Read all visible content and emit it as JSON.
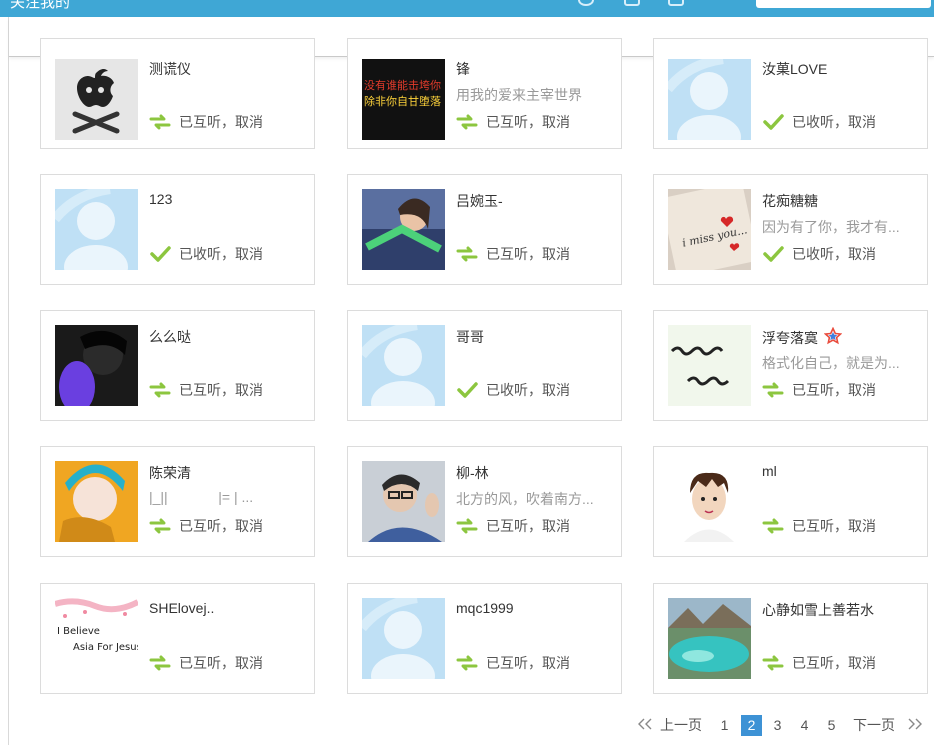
{
  "topbar": {
    "title": "关注我的",
    "accent": "#3fa7d5"
  },
  "cards": [
    {
      "name": "测谎仪",
      "signature": "",
      "status_icon": "mutual-arrows-icon",
      "status": "已互听，",
      "cancel": "取消",
      "avatar": "apple-skull"
    },
    {
      "name": "锋",
      "signature": "用我的爱来主宰世界",
      "status_icon": "mutual-arrows-icon",
      "status": "已互听，",
      "cancel": "取消",
      "avatar": "dark-text"
    },
    {
      "name": "汝菓LOVE",
      "signature": "",
      "status_icon": "check-icon",
      "status": "已收听，",
      "cancel": "取消",
      "avatar": "default"
    },
    {
      "name": "123",
      "signature": "",
      "status_icon": "check-icon",
      "status": "已收听，",
      "cancel": "取消",
      "avatar": "default"
    },
    {
      "name": "吕婉玉-",
      "signature": "",
      "status_icon": "mutual-arrows-icon",
      "status": "已互听，",
      "cancel": "取消",
      "avatar": "girl-photo"
    },
    {
      "name": "花痴糖糖",
      "signature": "因为有了你，我才有...",
      "status_icon": "check-icon",
      "status": "已收听，",
      "cancel": "取消",
      "avatar": "miss-you"
    },
    {
      "name": "么么哒",
      "signature": "",
      "status_icon": "mutual-arrows-icon",
      "status": "已互听，",
      "cancel": "取消",
      "avatar": "dark-purple"
    },
    {
      "name": "哥哥",
      "signature": "",
      "status_icon": "check-icon",
      "status": "已收听，",
      "cancel": "取消",
      "avatar": "default"
    },
    {
      "name": "浮夸落寞",
      "signature": "格式化自己，就是为...",
      "status_icon": "mutual-arrows-icon",
      "status": "已互听，",
      "cancel": "取消",
      "avatar": "handwriting",
      "badge": "star-icon"
    },
    {
      "name": "陈荣清",
      "signature": "|_||             |= | ...",
      "status_icon": "mutual-arrows-icon",
      "status": "已互听，",
      "cancel": "取消",
      "avatar": "orange-hood"
    },
    {
      "name": "柳-林",
      "signature": "北方的风，吹着南方...",
      "status_icon": "mutual-arrows-icon",
      "status": "已互听，",
      "cancel": "取消",
      "avatar": "boy-glasses"
    },
    {
      "name": "ml",
      "signature": "",
      "status_icon": "mutual-arrows-icon",
      "status": "已互听，",
      "cancel": "取消",
      "avatar": "cartoon-boy"
    },
    {
      "name": "SHElovej..",
      "signature": "",
      "status_icon": "mutual-arrows-icon",
      "status": "已互听，",
      "cancel": "取消",
      "avatar": "i-believe",
      "avatar_text": [
        "I Believe",
        "Asia For Jesus"
      ]
    },
    {
      "name": "mqc1999",
      "signature": "",
      "status_icon": "mutual-arrows-icon",
      "status": "已互听，",
      "cancel": "取消",
      "avatar": "default"
    },
    {
      "name": "心静如雪上善若水",
      "signature": "",
      "status_icon": "mutual-arrows-icon",
      "status": "已互听，",
      "cancel": "取消",
      "avatar": "lake"
    }
  ],
  "pagination": {
    "prev_icon": "double-chevron-left-icon",
    "prev": "上一页",
    "pages": [
      "1",
      "2",
      "3",
      "4",
      "5"
    ],
    "current": "2",
    "next": "下一页",
    "next_icon": "double-chevron-right-icon",
    "active_color": "#3d92d5"
  },
  "colors": {
    "status_green": "#8cc63f",
    "border": "#dcdcdc",
    "default_avatar_bg": "#bfe0f5"
  }
}
